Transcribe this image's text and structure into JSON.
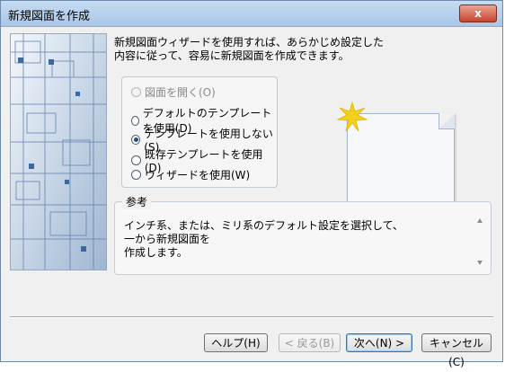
{
  "window": {
    "title": "新規図面を作成",
    "close_glyph": "x"
  },
  "main": {
    "description": "新規図面ウィザードを使用すれば、あらかじめ設定した内容に従って、容易に新規図面を作成できます。",
    "options": [
      {
        "label": "図面を開く(O)",
        "state": "disabled"
      },
      {
        "label": "デフォルトのテンプレートを使用(D)",
        "state": "unselected"
      },
      {
        "label": "テンプレートを使用しない(S)",
        "state": "selected"
      },
      {
        "label": "既存テンプレートを使用(D)",
        "state": "unselected"
      },
      {
        "label": "ウィザードを使用(W)",
        "state": "unselected"
      }
    ],
    "reference": {
      "label": "参考",
      "text": "インチ系、または、ミリ系のデフォルト設定を選択して、\n一から新規図面を\n作成します。"
    }
  },
  "buttons": {
    "help": "ヘルプ(H)",
    "back": "< 戻る(B)",
    "next": "次へ(N) >",
    "cancel": "キャンセル(C)"
  }
}
